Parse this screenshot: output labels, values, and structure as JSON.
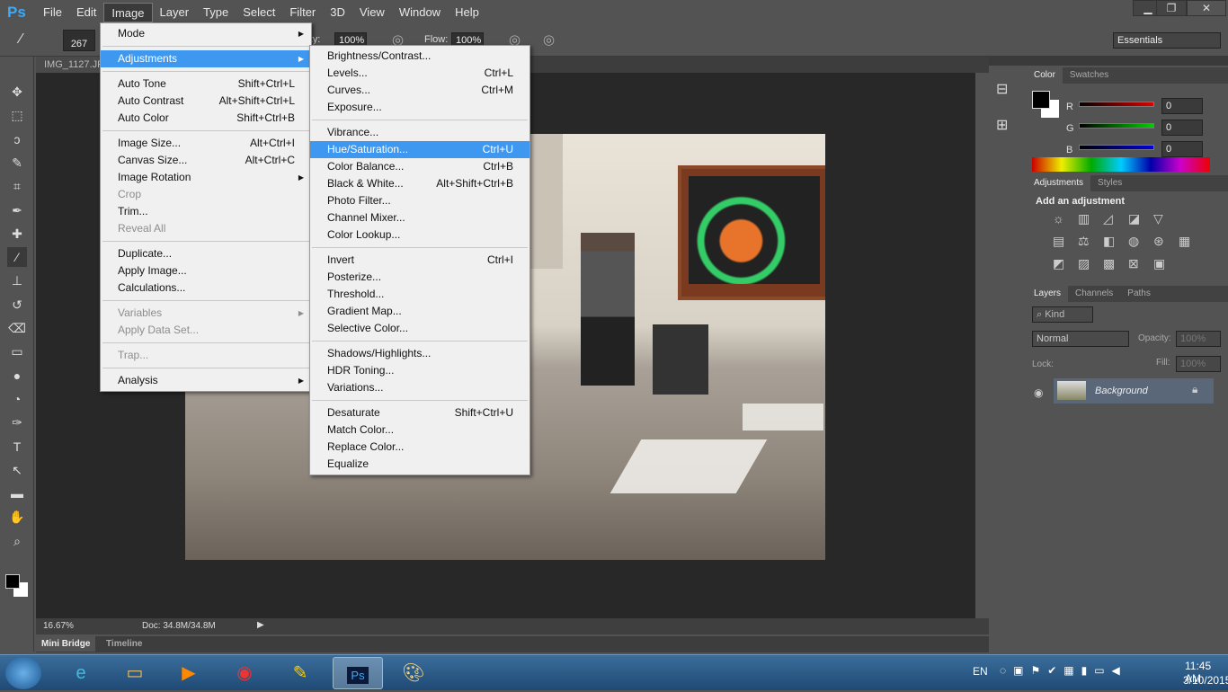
{
  "app": {
    "logo": "Ps",
    "menus": [
      "File",
      "Edit",
      "Image",
      "Layer",
      "Type",
      "Select",
      "Filter",
      "3D",
      "View",
      "Window",
      "Help"
    ],
    "active_menu": "Image"
  },
  "window_controls": {
    "minimize": "▁",
    "restore": "❐",
    "close": "✕"
  },
  "options": {
    "brush_size": "267",
    "opacity_label": "Opacity:",
    "opacity": "100%",
    "flow_label": "Flow:",
    "flow": "100%",
    "workspace": "Essentials"
  },
  "document": {
    "tab": "IMG_1127.JPG",
    "zoom": "16.67%",
    "doc_size": "Doc: 34.8M/34.8M"
  },
  "bottom_panel": {
    "tabs": [
      "Mini Bridge",
      "Timeline"
    ]
  },
  "image_menu": [
    {
      "label": "Mode",
      "sub": true
    },
    {
      "sep": true
    },
    {
      "label": "Adjustments",
      "sub": true,
      "hl": true
    },
    {
      "sep": true
    },
    {
      "label": "Auto Tone",
      "sc": "Shift+Ctrl+L"
    },
    {
      "label": "Auto Contrast",
      "sc": "Alt+Shift+Ctrl+L"
    },
    {
      "label": "Auto Color",
      "sc": "Shift+Ctrl+B"
    },
    {
      "sep": true
    },
    {
      "label": "Image Size...",
      "sc": "Alt+Ctrl+I"
    },
    {
      "label": "Canvas Size...",
      "sc": "Alt+Ctrl+C"
    },
    {
      "label": "Image Rotation",
      "sub": true
    },
    {
      "label": "Crop",
      "dis": true
    },
    {
      "label": "Trim..."
    },
    {
      "label": "Reveal All",
      "dis": true
    },
    {
      "sep": true
    },
    {
      "label": "Duplicate..."
    },
    {
      "label": "Apply Image..."
    },
    {
      "label": "Calculations..."
    },
    {
      "sep": true
    },
    {
      "label": "Variables",
      "sub": true,
      "dis": true
    },
    {
      "label": "Apply Data Set...",
      "dis": true
    },
    {
      "sep": true
    },
    {
      "label": "Trap...",
      "dis": true
    },
    {
      "sep": true
    },
    {
      "label": "Analysis",
      "sub": true
    }
  ],
  "adjustments_menu": [
    {
      "label": "Brightness/Contrast..."
    },
    {
      "label": "Levels...",
      "sc": "Ctrl+L"
    },
    {
      "label": "Curves...",
      "sc": "Ctrl+M"
    },
    {
      "label": "Exposure..."
    },
    {
      "sep": true
    },
    {
      "label": "Vibrance..."
    },
    {
      "label": "Hue/Saturation...",
      "sc": "Ctrl+U",
      "hl": true
    },
    {
      "label": "Color Balance...",
      "sc": "Ctrl+B"
    },
    {
      "label": "Black & White...",
      "sc": "Alt+Shift+Ctrl+B"
    },
    {
      "label": "Photo Filter..."
    },
    {
      "label": "Channel Mixer..."
    },
    {
      "label": "Color Lookup..."
    },
    {
      "sep": true
    },
    {
      "label": "Invert",
      "sc": "Ctrl+I"
    },
    {
      "label": "Posterize..."
    },
    {
      "label": "Threshold..."
    },
    {
      "label": "Gradient Map..."
    },
    {
      "label": "Selective Color..."
    },
    {
      "sep": true
    },
    {
      "label": "Shadows/Highlights..."
    },
    {
      "label": "HDR Toning..."
    },
    {
      "label": "Variations..."
    },
    {
      "sep": true
    },
    {
      "label": "Desaturate",
      "sc": "Shift+Ctrl+U"
    },
    {
      "label": "Match Color..."
    },
    {
      "label": "Replace Color..."
    },
    {
      "label": "Equalize"
    }
  ],
  "color_panel": {
    "tabs": [
      "Color",
      "Swatches"
    ],
    "channels": [
      {
        "label": "R",
        "value": "0",
        "color": "#e00000"
      },
      {
        "label": "G",
        "value": "0",
        "color": "#00d000"
      },
      {
        "label": "B",
        "value": "0",
        "color": "#0000e0"
      }
    ]
  },
  "adjustments_panel": {
    "tabs": [
      "Adjustments",
      "Styles"
    ],
    "heading": "Add an adjustment"
  },
  "layers_panel": {
    "tabs": [
      "Layers",
      "Channels",
      "Paths"
    ],
    "filter": "Kind",
    "blend_mode": "Normal",
    "opacity_label": "Opacity:",
    "opacity": "100%",
    "lock_label": "Lock:",
    "fill_label": "Fill:",
    "fill": "100%",
    "layer_name": "Background"
  },
  "taskbar": {
    "lang": "EN",
    "time": "11:45 AM",
    "date": "3/10/2015"
  }
}
